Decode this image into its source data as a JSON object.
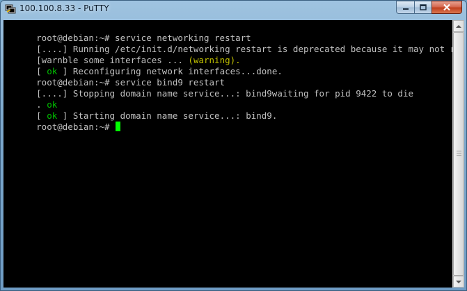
{
  "window": {
    "title": "100.100.8.33 - PuTTY",
    "icons": {
      "app": "putty-icon",
      "minimize": "minimize-icon",
      "maximize": "maximize-icon",
      "close": "close-icon"
    }
  },
  "colors": {
    "terminal_bg": "#000000",
    "text": "#c0c0c0",
    "ok": "#00c000",
    "warning": "#c0c000",
    "cursor": "#00ff00"
  },
  "terminal": {
    "lines": [
      [
        {
          "t": "root@debian:~# service networking restart"
        }
      ],
      [
        {
          "t": "[....] Running /etc/init.d/networking restart is deprecated because it may not r"
        }
      ],
      [
        {
          "t": "[warn"
        },
        {
          "t": "ble some interfaces ... "
        },
        {
          "t": "(warning).",
          "c": "warn"
        }
      ],
      [
        {
          "t": "[ "
        },
        {
          "t": "ok",
          "c": "ok"
        },
        {
          "t": " ] Reconfiguring network interfaces...done."
        }
      ],
      [
        {
          "t": "root@debian:~# service bind9 restart"
        }
      ],
      [
        {
          "t": "[....] Stopping domain name service...: bind9waiting for pid 9422 to die"
        }
      ],
      [
        {
          "t": ". "
        },
        {
          "t": "ok",
          "c": "ok"
        }
      ],
      [
        {
          "t": "[ "
        },
        {
          "t": "ok",
          "c": "ok"
        },
        {
          "t": " ] Starting domain name service...: bind9."
        }
      ]
    ],
    "prompt": "root@debian:~# "
  }
}
